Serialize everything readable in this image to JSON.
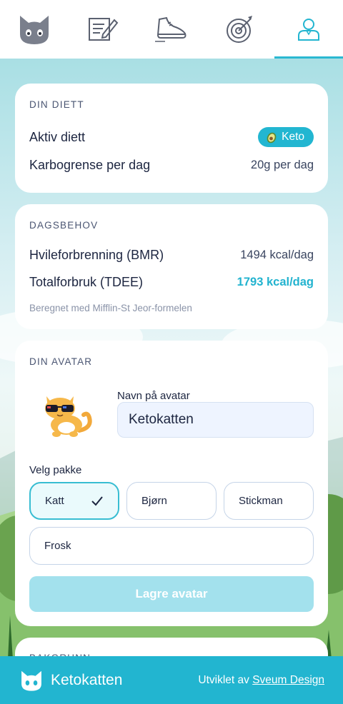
{
  "nav": {
    "tabs": [
      {
        "name": "cat-home",
        "icon": "cat-face-icon",
        "active": false
      },
      {
        "name": "diary",
        "icon": "notebook-pen-icon",
        "active": false
      },
      {
        "name": "activity",
        "icon": "sneaker-icon",
        "active": false
      },
      {
        "name": "goals",
        "icon": "target-arrow-icon",
        "active": false
      },
      {
        "name": "profile",
        "icon": "user-icon",
        "active": true
      }
    ]
  },
  "diet": {
    "section_title": "DIN DIETT",
    "active_label": "Aktiv diett",
    "active_badge_icon": "avocado-icon",
    "active_badge": "Keto",
    "carb_label": "Karbogrense per dag",
    "carb_value": "20g per dag"
  },
  "needs": {
    "section_title": "DAGSBEHOV",
    "bmr_label": "Hvileforbrenning (BMR)",
    "bmr_value": "1494 kcal/dag",
    "tdee_label": "Totalforbruk (TDEE)",
    "tdee_value": "1793 kcal/dag",
    "note": "Beregnet med Mifflin-St Jeor-formelen"
  },
  "avatar": {
    "section_title": "DIN AVATAR",
    "name_label": "Navn på avatar",
    "name_value": "Ketokatten",
    "package_label": "Velg pakke",
    "packages": [
      "Katt",
      "Bjørn",
      "Stickman",
      "Frosk"
    ],
    "selected_package": "Katt",
    "save_button": "Lagre avatar"
  },
  "next_section_title": "BAKGRUNN",
  "footer": {
    "brand": "Ketokatten",
    "credit_prefix": "Utviklet av",
    "credit_link": "Sveum Design"
  },
  "colors": {
    "accent": "#22b5d0",
    "text": "#1c2540",
    "card": "#ffffff"
  }
}
